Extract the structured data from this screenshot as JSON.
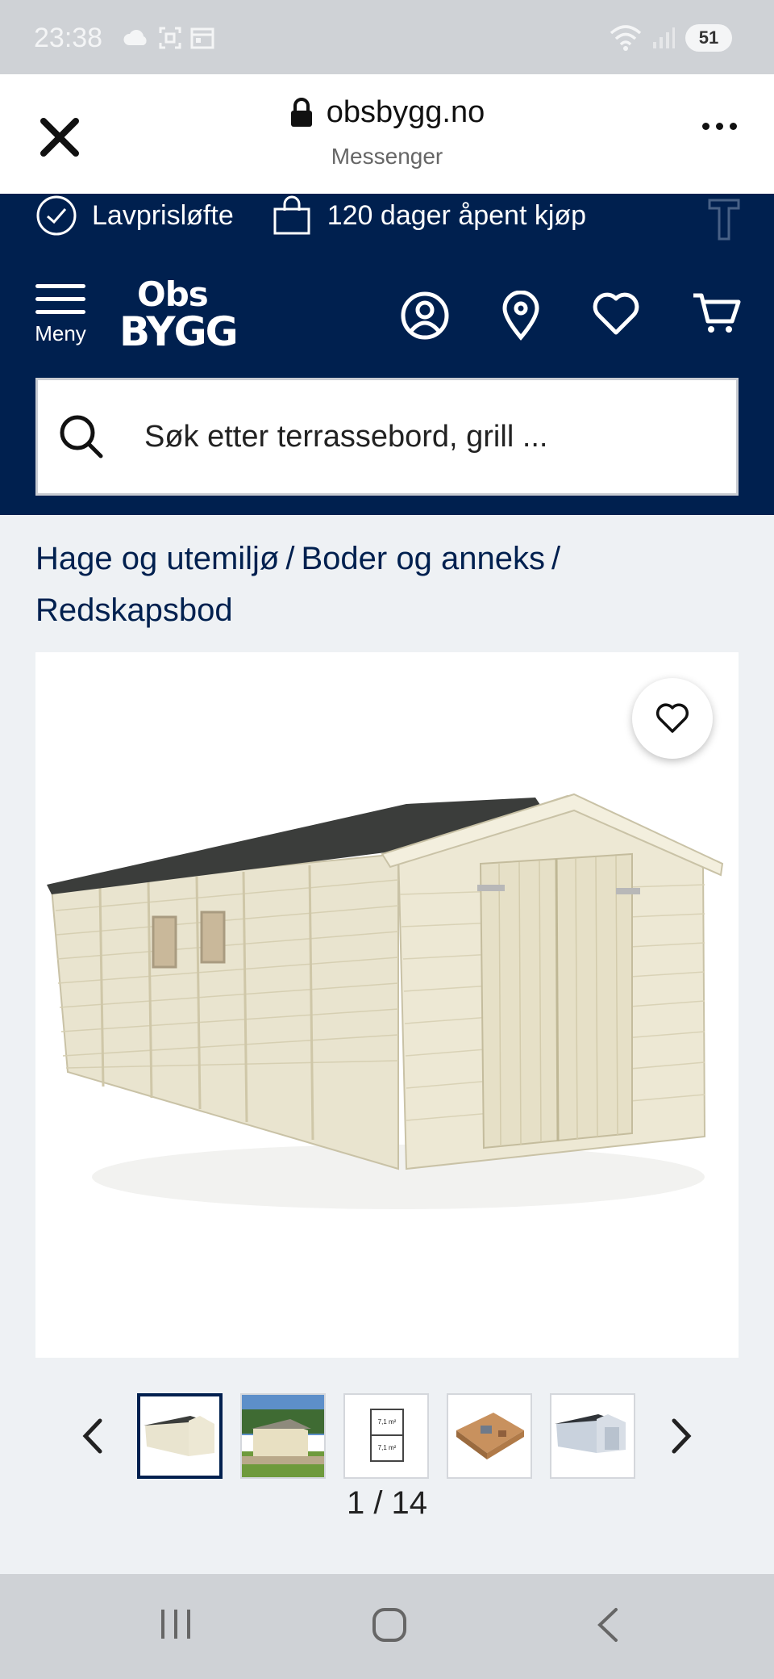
{
  "status_bar": {
    "time": "23:38",
    "battery": "51",
    "icons": [
      "cloud-icon",
      "screenshot-icon",
      "calendar-icon",
      "wifi-icon",
      "signal-icon"
    ]
  },
  "browser": {
    "url": "obsbygg.no",
    "source": "Messenger",
    "icons": [
      "close-icon",
      "lock-icon",
      "more-icon"
    ]
  },
  "header": {
    "usp": [
      {
        "label": "Lavprisløfte",
        "icon": "check-circle-icon"
      },
      {
        "label": "120 dager åpent kjøp",
        "icon": "shopping-bag-icon"
      }
    ],
    "menu_label": "Meny",
    "logo": {
      "top": "Obs",
      "bottom": "BYGG"
    },
    "icons": [
      "user-icon",
      "location-icon",
      "heart-icon",
      "cart-icon"
    ]
  },
  "search": {
    "placeholder": "Søk etter terrassebord, grill ..."
  },
  "breadcrumb": {
    "items": [
      "Hage og utemiljø",
      "Boder og anneks",
      "Redskapsbod"
    ],
    "separator": "/"
  },
  "gallery": {
    "current": "1",
    "total": "14",
    "counter_text": "1 / 14",
    "thumb_count": 5,
    "thumb_labels": [
      "7,1 m²",
      "7,1 m²"
    ]
  },
  "colors": {
    "brand_navy": "#00204f",
    "status_gray": "#cfd2d6",
    "page_bg": "#eef1f4"
  }
}
